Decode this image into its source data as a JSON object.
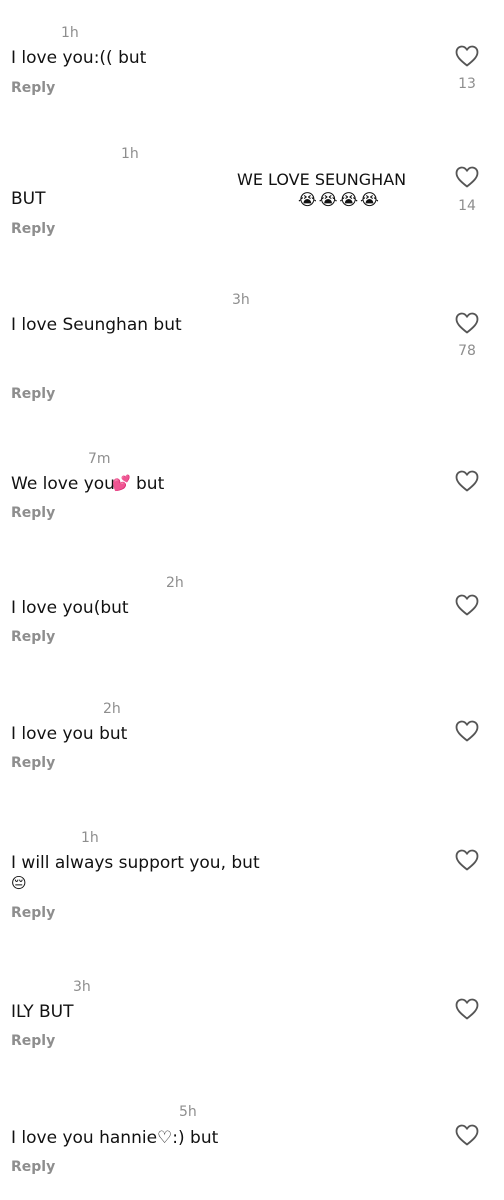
{
  "comments": [
    {
      "time": "1h",
      "text": "I love you:(( but",
      "reply": "Reply",
      "likes": "13"
    },
    {
      "time": "1h",
      "text": "BUT",
      "reply": "Reply",
      "likes": "14",
      "overlay_text": "WE LOVE SEUNGHAN",
      "overlay_emojis": "😭😭😭😭"
    },
    {
      "time": "3h",
      "text": "I love Seunghan but",
      "reply": "Reply",
      "likes": "78"
    },
    {
      "time": "7m",
      "text_before": "We love you",
      "emoji": "💕",
      "text_after": "but",
      "reply": "Reply"
    },
    {
      "time": "2h",
      "text": "I love you(but",
      "reply": "Reply"
    },
    {
      "time": "2h",
      "text": "I love you but",
      "reply": "Reply"
    },
    {
      "time": "1h",
      "text": "I will always support you, but",
      "emoji": "😔",
      "reply": "Reply"
    },
    {
      "time": "3h",
      "text": "ILY BUT",
      "reply": "Reply"
    },
    {
      "time": "5h",
      "text": "I love you hannie♡:) but",
      "reply": "Reply"
    }
  ],
  "icons": {
    "like": "heart-outline-icon"
  },
  "colors": {
    "text": "#111111",
    "muted": "#8e8e8e",
    "background": "#ffffff"
  }
}
